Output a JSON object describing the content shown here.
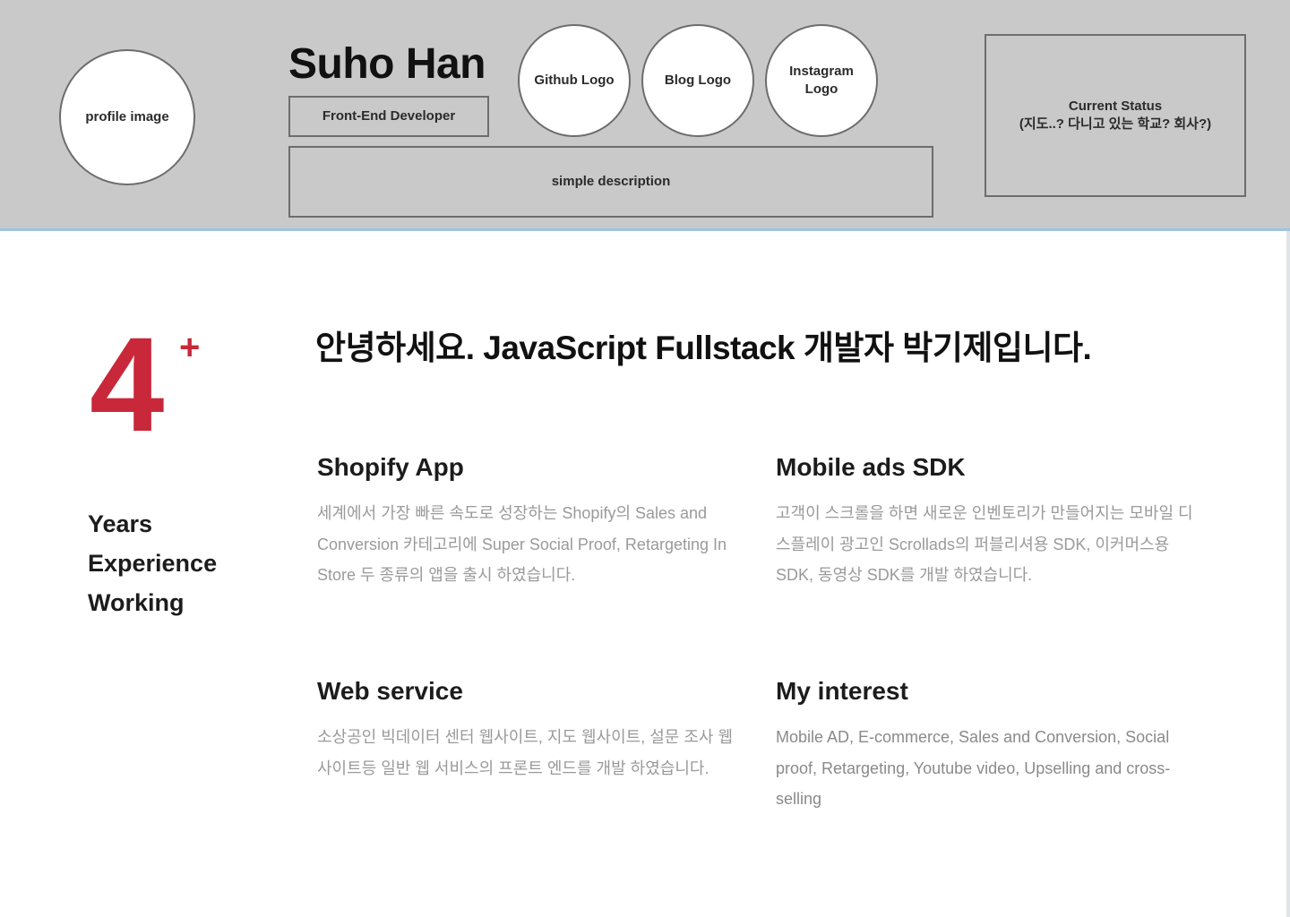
{
  "header": {
    "profile_image_label": "profile image",
    "name": "Suho Han",
    "role": "Front-End Developer",
    "github_logo_label": "Github Logo",
    "blog_logo_label": "Blog Logo",
    "instagram_logo_label_line1": "Instagram",
    "instagram_logo_label_line2": "Logo",
    "description_label": "simple description",
    "status_line1": "Current Status",
    "status_line2": "(지도..? 다니고 있는 학교? 회사?)"
  },
  "experience": {
    "number": "4",
    "plus": "+",
    "label_line1": "Years",
    "label_line2": "Experience",
    "label_line3": "Working"
  },
  "intro": {
    "headline": "안녕하세요. JavaScript Fullstack 개발자 박기제입니다."
  },
  "cards": [
    {
      "title": "Shopify App",
      "body": "세계에서 가장 빠른 속도로 성장하는 Shopify의 Sales and Conversion 카테고리에 Super Social Proof, Retargeting In Store 두 종류의 앱을 출시 하였습니다."
    },
    {
      "title": "Mobile ads SDK",
      "body": "고객이 스크롤을 하면 새로운 인벤토리가 만들어지는 모바일 디스플레이 광고인 Scrollads의 퍼블리셔용 SDK, 이커머스용 SDK, 동영상 SDK를 개발 하였습니다."
    },
    {
      "title": "Web service",
      "body": "소상공인 빅데이터 센터 웹사이트, 지도 웹사이트, 설문 조사 웹사이트등 일반 웹 서비스의 프론트 엔드를 개발 하였습니다."
    },
    {
      "title": "My interest",
      "body": "Mobile AD, E-commerce, Sales and Conversion, Social proof, Retargeting, Youtube video, Upselling and cross-selling"
    }
  ],
  "colors": {
    "accent": "#c8283a",
    "header_bg": "#c9c9c9",
    "muted_text": "#9a9a9a"
  }
}
